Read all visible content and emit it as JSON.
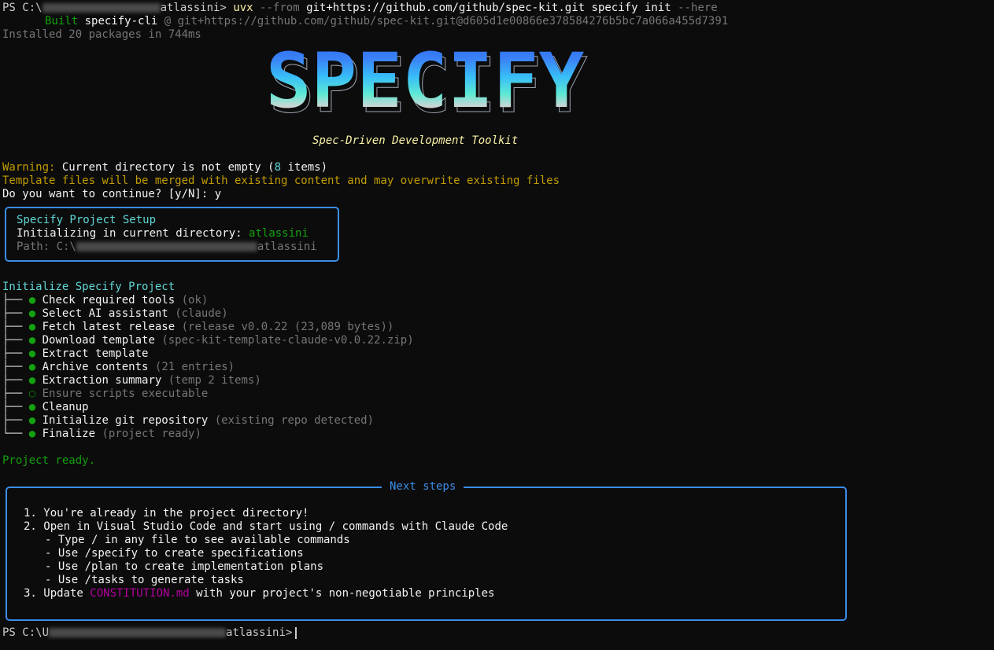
{
  "terminal": {
    "cmd_prompt": "PS C:\\",
    "cmd_user_tail": "atlassini>",
    "cmd_exe": "uvx",
    "cmd_flag_from": "--from",
    "cmd_repo": "git+https://github.com/github/spec-kit.git",
    "cmd_args": "specify init",
    "cmd_flag_here": "--here",
    "built_label": "Built",
    "built_pkg": "specify-cli",
    "built_src": "@ git+https://github.com/github/spec-kit.git@d605d1e00866e378584276b5bc7a066a455d7391",
    "installed_line": "Installed 20 packages in 744ms",
    "banner_text": "SPECIFY",
    "tagline": "Spec-Driven Development Toolkit",
    "warning_label": "Warning:",
    "warning_text": "Current directory is not empty (",
    "warning_count": "8",
    "warning_tail": " items)",
    "merge_text": "Template files will be merged with existing content and may overwrite existing files",
    "continue_prompt": "Do you want to continue? [y/N]: y"
  },
  "setup_panel": {
    "title": "Specify Project Setup",
    "init_label": "Initializing in current directory:",
    "init_dir": "atlassini",
    "path_label": "Path: C:\\",
    "path_tail": "atlassini"
  },
  "init": {
    "heading": "Initialize Specify Project",
    "steps": [
      {
        "label": "Check required tools",
        "detail": "(ok)"
      },
      {
        "label": "Select AI assistant",
        "detail": "(claude)"
      },
      {
        "label": "Fetch latest release",
        "detail": "(release v0.0.22 (23,089 bytes))"
      },
      {
        "label": "Download template",
        "detail": "(spec-kit-template-claude-v0.0.22.zip)"
      },
      {
        "label": "Extract template",
        "detail": ""
      },
      {
        "label": "Archive contents",
        "detail": "(21 entries)"
      },
      {
        "label": "Extraction summary",
        "detail": "(temp 2 items)"
      },
      {
        "label": "Ensure scripts executable",
        "detail": ""
      },
      {
        "label": "Cleanup",
        "detail": ""
      },
      {
        "label": "Initialize git repository",
        "detail": "(existing repo detected)"
      },
      {
        "label": "Finalize",
        "detail": "(project ready)"
      }
    ],
    "ready": "Project ready."
  },
  "next_steps": {
    "title": "Next steps",
    "s1": "1. You're already in the project directory!",
    "s2": "2. Open in Visual Studio Code and start using / commands with Claude Code",
    "s2a": "- Type / in any file to see available commands",
    "s2b": "- Use /specify to create specifications",
    "s2c": "- Use /plan to create implementation plans",
    "s2d": "- Use /tasks to generate tasks",
    "s3_pre": "3. Update",
    "s3_file": "CONSTITUTION.md",
    "s3_post": "with your project's non-negotiable principles"
  },
  "final_prompt": {
    "prefix": "PS C:\\U",
    "tail": "atlassini>"
  },
  "colors": {
    "background": "#0c0c0c",
    "accent": "#3b8eea",
    "success": "#13a10e",
    "warning": "#c19c00",
    "heading": "#61d6d6",
    "file": "#b4009e"
  }
}
